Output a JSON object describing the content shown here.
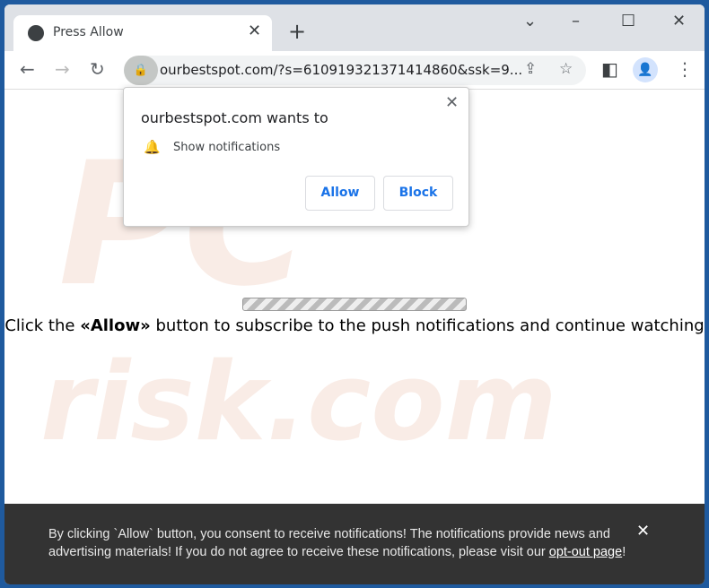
{
  "tab": {
    "title": "Press Allow"
  },
  "address": {
    "url": "ourbestspot.com/?s=610919321371414860&ssk=9..."
  },
  "popup": {
    "title": "ourbestspot.com wants to",
    "permission": "Show notifications",
    "allow": "Allow",
    "block": "Block"
  },
  "page": {
    "msg_pre": "Click the ",
    "msg_bold": "«Allow»",
    "msg_post": " button to subscribe to the push notifications and continue watching",
    "progress_state": "indeterminate"
  },
  "watermark": {
    "top": "PC",
    "bottom": "risk.com"
  },
  "banner": {
    "text": "By clicking `Allow` button, you consent to receive notifications! The notifications provide news and advertising materials! If you do not agree to receive these notifications, please visit our ",
    "link": "opt-out page",
    "end": "!"
  },
  "colors": {
    "frame": "#1f5a9e",
    "banner_bg": "#333333",
    "button_text": "#1a73e8"
  }
}
